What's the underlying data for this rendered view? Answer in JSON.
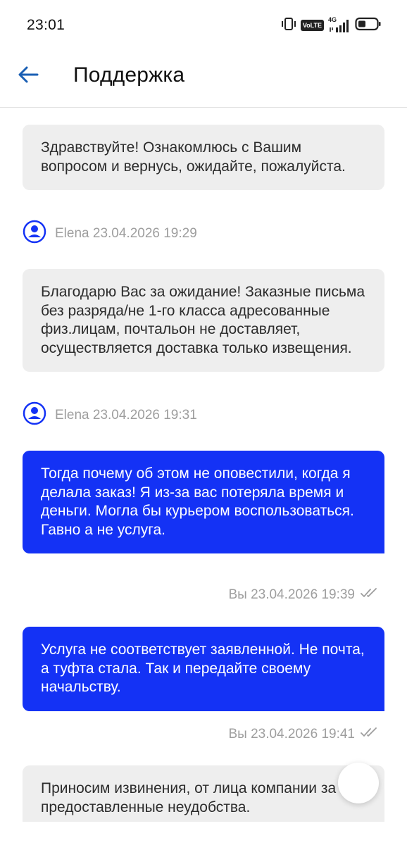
{
  "status_bar": {
    "time": "23:01",
    "volte": "VoLTE",
    "network": "4G"
  },
  "header": {
    "title": "Поддержка"
  },
  "messages": [
    {
      "direction": "incoming",
      "text": "Здравствуйте! Ознакомлюсь с Вашим вопросом и вернусь, ожидайте, пожалуйста.",
      "meta": "Elena 23.04.2026 19:29"
    },
    {
      "direction": "incoming",
      "text": "Благодарю Вас за ожидание! Заказные письма без разряда/не 1-го класса адресованные физ.лицам, почтальон не доставляет, осуществляется доставка только извещения.",
      "meta": "Elena 23.04.2026 19:31"
    },
    {
      "direction": "outgoing",
      "text": "Тогда почему об этом не оповестили, когда я делала заказ! Я из-за вас потеряла время и деньги. Могла бы курьером воспользоваться. Гавно а не услуга.",
      "meta": "Вы 23.04.2026 19:39"
    },
    {
      "direction": "outgoing",
      "text": "Услуга не соответствует заявленной. Не почта, а туфта стала. Так и передайте своему начальству.",
      "meta": "Вы 23.04.2026 19:41"
    },
    {
      "direction": "incoming",
      "text": "Приносим извинения, от лица компании за предоставленные неудобства.",
      "meta": ""
    }
  ],
  "colors": {
    "accent": "#1432f5",
    "incoming_bubble": "#eeeeee",
    "meta_text": "#9e9e9e",
    "back_arrow": "#1a5fb4"
  },
  "icons": {
    "back": "arrow-left-icon",
    "avatar": "user-circle-icon",
    "read_status": "double-check-icon",
    "battery": "battery-icon",
    "signal": "signal-bars-icon",
    "vibrate": "vibrate-icon"
  }
}
